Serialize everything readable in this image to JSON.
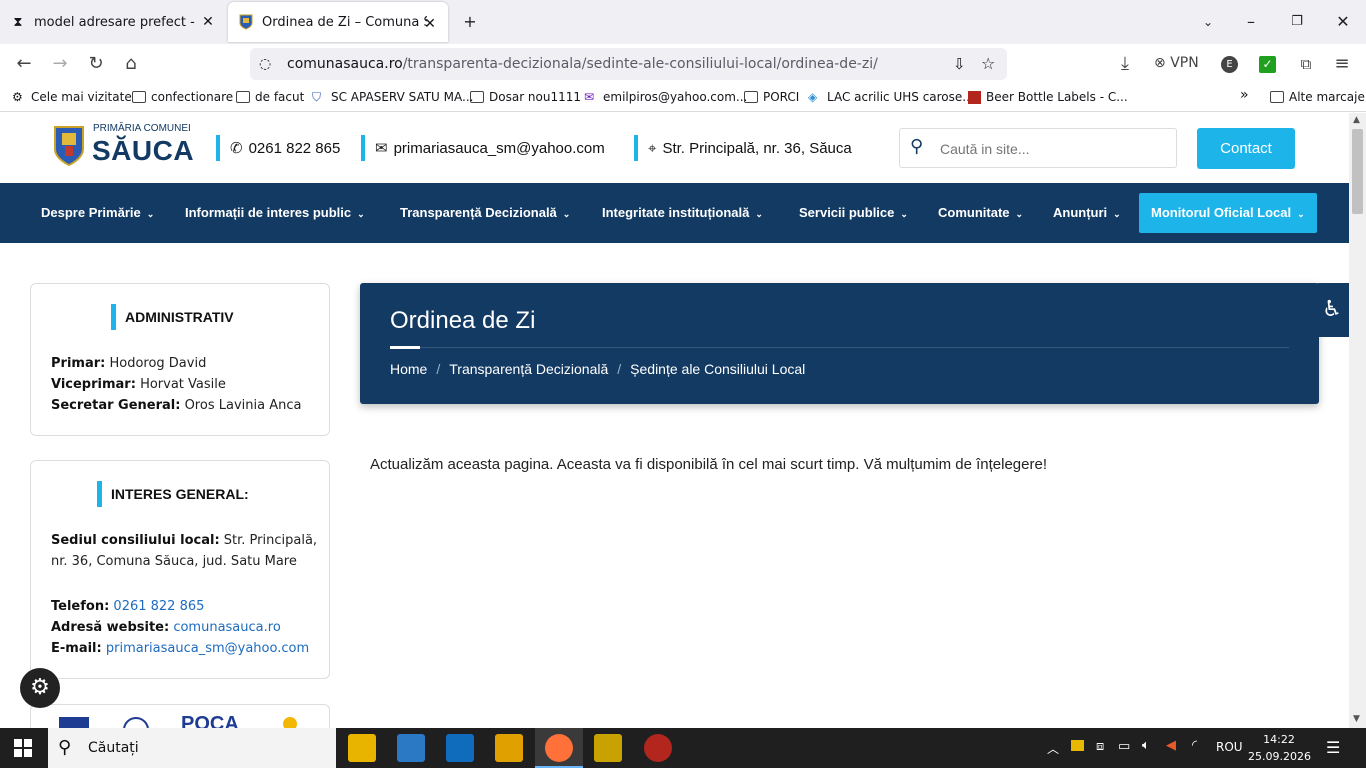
{
  "browser": {
    "tabs": [
      {
        "label": "model adresare prefect - Googl",
        "icon": "hourglass-icon"
      },
      {
        "label": "Ordinea de Zi – Comuna Săuca",
        "icon": "crest-icon"
      }
    ],
    "url_host": "comunasauca.ro",
    "url_path": "/transparenta-decizionala/sedinte-ale-consiliului-local/ordinea-de-zi/",
    "vpn_label": "VPN",
    "bookmarks": [
      "Cele mai vizitate",
      "confectionare",
      "de facut",
      "SC APASERV SATU MA...",
      "Dosar nou1111",
      "emilpiros@yahoo.com...",
      "PORCI",
      "LAC acrilic UHS carose...",
      "Beer Bottle Labels - C..."
    ],
    "other_bookmarks": "Alte marcaje"
  },
  "header": {
    "logo_small": "PRIMĂRIA COMUNEI",
    "logo_big": "SĂUCA",
    "phone": "0261 822 865",
    "email": "primariasauca_sm@yahoo.com",
    "address": "Str. Principală, nr. 36, Săuca",
    "search_placeholder": "Caută in site...",
    "contact_label": "Contact"
  },
  "nav": [
    "Despre Primărie",
    "Informații de interes public",
    "Transparență Decizională",
    "Integritate instituțională",
    "Servicii publice",
    "Comunitate",
    "Anunțuri",
    "Monitorul Oficial Local"
  ],
  "sidebar": {
    "admin": {
      "title": "ADMINISTRATIV",
      "rows": [
        {
          "label": "Primar:",
          "value": "Hodorog David"
        },
        {
          "label": "Viceprimar:",
          "value": "Horvat Vasile"
        },
        {
          "label": "Secretar General:",
          "value": "Oros Lavinia Anca"
        }
      ]
    },
    "general": {
      "title": "INTERES GENERAL:",
      "seat_label": "Sediul consiliului local:",
      "seat_value_1": "Str. Principală,",
      "seat_value_2": "nr. 36, Comuna Săuca, jud. Satu Mare",
      "phone_label": "Telefon:",
      "phone_value": "0261 822 865",
      "web_label": "Adresă website:",
      "web_value": "comunasauca.ro",
      "email_label": "E-mail:",
      "email_value": "primariasauca_sm@yahoo.com"
    }
  },
  "hero": {
    "title": "Ordinea de Zi",
    "breadcrumbs": [
      "Home",
      "Transparență Decizională",
      "Ședințe ale Consiliului Local"
    ]
  },
  "message": "Actualizăm aceasta pagina. Aceasta va fi disponibilă în cel mai scurt timp. Vă mulțumim de înțelegere!",
  "taskbar": {
    "search_placeholder": "Căutați",
    "lang": "ROU",
    "time": "14:22",
    "date": "25.09.2026"
  },
  "colors": {
    "accent": "#1db4ea",
    "navy": "#133a63"
  }
}
